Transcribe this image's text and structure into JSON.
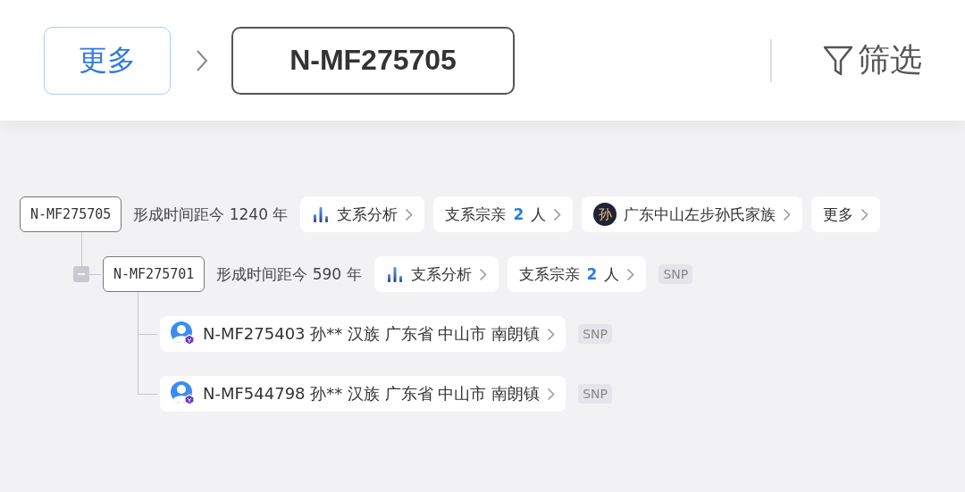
{
  "header": {
    "breadcrumb": [
      {
        "label": "更多",
        "selected": false
      },
      {
        "label": "N-MF275705",
        "selected": true
      }
    ],
    "filter": {
      "label": "筛选"
    }
  },
  "tree": [
    {
      "kind": "branch",
      "id": "N-MF275705",
      "age": "形成时间距今 1240 年",
      "chips": [
        {
          "kind": "analysis",
          "label": "支系分析"
        },
        {
          "kind": "relatives",
          "label": "支系宗亲",
          "count": "2",
          "unit": "人"
        },
        {
          "kind": "clan",
          "avatar": "孙",
          "label": "广东中山左步孙氏家族"
        },
        {
          "kind": "more",
          "label": "更多"
        }
      ],
      "children": [
        {
          "kind": "branch",
          "id": "N-MF275701",
          "age": "形成时间距今 590 年",
          "expanded": true,
          "chips": [
            {
              "kind": "analysis",
              "label": "支系分析"
            },
            {
              "kind": "relatives",
              "label": "支系宗亲",
              "count": "2",
              "unit": "人"
            }
          ],
          "tag": "SNP",
          "children": [
            {
              "kind": "person",
              "label": "N-MF275403 孙** 汉族 广东省 中山市 南朗镇",
              "tag": "SNP"
            },
            {
              "kind": "person",
              "label": "N-MF544798 孙** 汉族 广东省 中山市 南朗镇",
              "tag": "SNP"
            }
          ]
        }
      ]
    }
  ]
}
